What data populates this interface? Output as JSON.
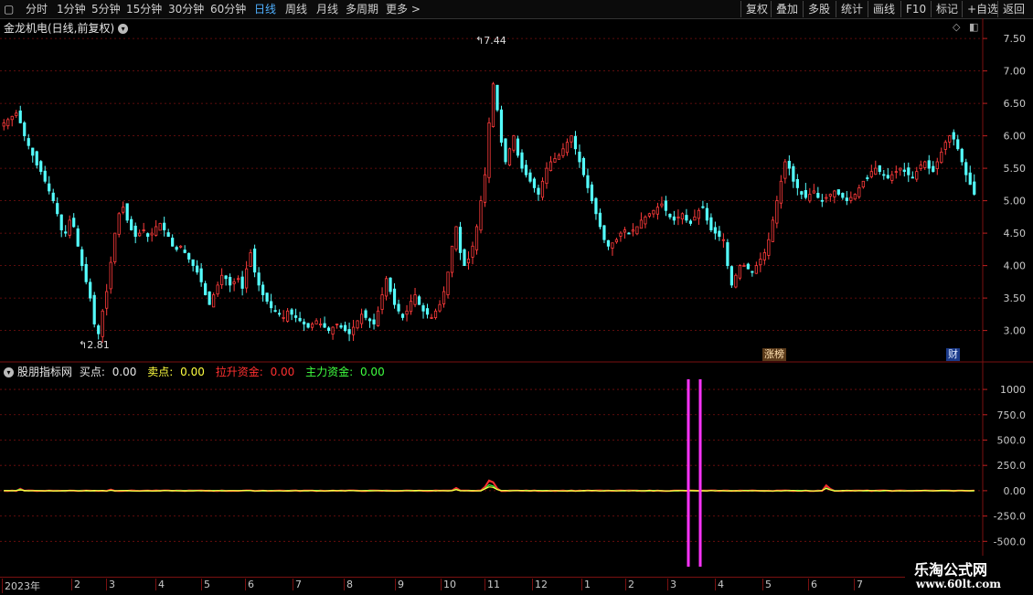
{
  "toolbar": {
    "periods": [
      "分时",
      "1分钟",
      "5分钟",
      "15分钟",
      "30分钟",
      "60分钟",
      "日线",
      "周线",
      "月线",
      "多周期",
      "更多 >"
    ],
    "active_period": "日线",
    "buttons": [
      "复权",
      "叠加",
      "多股",
      "统计",
      "画线",
      "F10",
      "标记",
      "+自选",
      "返回"
    ]
  },
  "stock": {
    "title": "金龙机电(日线,前复权)"
  },
  "price_axis": {
    "ticks": [
      "7.50",
      "7.00",
      "6.50",
      "6.00",
      "5.50",
      "5.00",
      "4.50",
      "4.00",
      "3.50",
      "3.00"
    ]
  },
  "price_annotations": {
    "high_label": "7.44",
    "low_label": "2.81"
  },
  "event_badges": [
    {
      "label": "涨榜",
      "color": "#c8a070"
    },
    {
      "label": "财",
      "color": "#3a6fd8"
    }
  ],
  "indicator": {
    "name": "股朋指标网",
    "items": [
      {
        "label": "买点:",
        "value": "0.00",
        "color": "#e6e6e6"
      },
      {
        "label": "卖点:",
        "value": "0.00",
        "color": "#ffff40"
      },
      {
        "label": "拉升资金:",
        "value": "0.00",
        "color": "#ff3030"
      },
      {
        "label": "主力资金:",
        "value": "0.00",
        "color": "#40ff40"
      }
    ]
  },
  "indicator_axis": {
    "ticks": [
      "1000",
      "750.0",
      "500.0",
      "250.0",
      "0.00",
      "-250.0",
      "-500.0"
    ]
  },
  "time_axis": {
    "labels": [
      "2023年",
      "2",
      "3",
      "4",
      "5",
      "6",
      "7",
      "8",
      "9",
      "10",
      "11",
      "12",
      "1",
      "2",
      "3",
      "4",
      "5",
      "6",
      "7"
    ]
  },
  "watermark": {
    "title": "乐淘公式网",
    "url": "www.60lt.com"
  },
  "colors": {
    "up": "#ff3b3b",
    "down": "#54ffff",
    "accent": "#4fb0ff",
    "grid": "#7a1010",
    "signal": "#ff33ff"
  },
  "chart_data": {
    "type": "candlestick",
    "ylim": [
      2.6,
      7.6
    ],
    "indicator_ylim": [
      -750,
      1100
    ],
    "closes": [
      6.2,
      6.25,
      6.3,
      6.35,
      6.2,
      6.0,
      5.85,
      5.7,
      5.55,
      5.45,
      5.3,
      5.15,
      5.0,
      4.8,
      4.55,
      4.5,
      4.7,
      4.6,
      4.3,
      4.0,
      3.75,
      3.5,
      3.1,
      2.95,
      3.3,
      3.6,
      4.05,
      4.5,
      4.8,
      4.9,
      4.7,
      4.55,
      4.45,
      4.5,
      4.55,
      4.45,
      4.5,
      4.6,
      4.65,
      4.55,
      4.45,
      4.3,
      4.25,
      4.3,
      4.2,
      4.1,
      4.0,
      3.9,
      3.75,
      3.55,
      3.4,
      3.55,
      3.7,
      3.85,
      3.8,
      3.7,
      3.75,
      3.8,
      3.65,
      3.95,
      4.2,
      3.9,
      3.7,
      3.55,
      3.45,
      3.35,
      3.3,
      3.25,
      3.2,
      3.3,
      3.25,
      3.2,
      3.15,
      3.1,
      3.05,
      3.1,
      3.15,
      3.1,
      3.05,
      3.0,
      3.05,
      3.1,
      3.05,
      3.0,
      2.95,
      3.05,
      3.15,
      3.25,
      3.2,
      3.15,
      3.1,
      3.3,
      3.55,
      3.8,
      3.6,
      3.4,
      3.3,
      3.2,
      3.3,
      3.45,
      3.55,
      3.4,
      3.3,
      3.25,
      3.2,
      3.3,
      3.4,
      3.6,
      3.9,
      4.3,
      4.6,
      4.2,
      4.0,
      4.1,
      4.3,
      4.6,
      5.0,
      5.4,
      6.2,
      6.8,
      6.4,
      5.9,
      5.6,
      5.8,
      6.0,
      5.7,
      5.5,
      5.4,
      5.3,
      5.2,
      5.1,
      5.3,
      5.5,
      5.6,
      5.65,
      5.7,
      5.8,
      5.9,
      6.0,
      5.8,
      5.6,
      5.4,
      5.2,
      5.0,
      4.8,
      4.6,
      4.4,
      4.3,
      4.35,
      4.4,
      4.5,
      4.55,
      4.5,
      4.55,
      4.6,
      4.7,
      4.75,
      4.8,
      4.85,
      4.9,
      4.95,
      4.85,
      4.75,
      4.7,
      4.75,
      4.8,
      4.7,
      4.65,
      4.75,
      4.85,
      4.9,
      4.7,
      4.55,
      4.5,
      4.45,
      4.4,
      4.0,
      3.7,
      3.85,
      4.0,
      4.0,
      3.95,
      3.9,
      4.0,
      4.1,
      4.2,
      4.4,
      4.7,
      5.0,
      5.3,
      5.6,
      5.5,
      5.3,
      5.2,
      5.1,
      5.05,
      5.1,
      5.15,
      5.05,
      5.0,
      5.05,
      5.1,
      5.15,
      5.1,
      5.05,
      5.0,
      5.05,
      5.1,
      5.2,
      5.3,
      5.35,
      5.45,
      5.5,
      5.45,
      5.4,
      5.35,
      5.4,
      5.45,
      5.5,
      5.45,
      5.4,
      5.35,
      5.45,
      5.55,
      5.6,
      5.5,
      5.45,
      5.6,
      5.75,
      5.9,
      6.0,
      5.95,
      5.8,
      5.6,
      5.4,
      5.25,
      5.1
    ],
    "high_marker": {
      "value": 7.44
    },
    "low_marker": {
      "value": 2.81
    }
  }
}
